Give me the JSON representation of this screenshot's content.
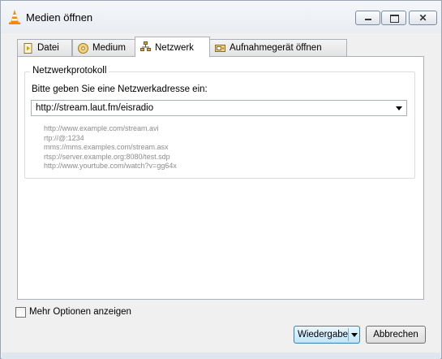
{
  "window": {
    "title": "Medien öffnen",
    "icon": "vlc-cone-icon",
    "controls": {
      "minimize": "minimize-icon",
      "maximize": "maximize-icon",
      "close_glyph": "✕"
    }
  },
  "tabs": [
    {
      "label": "Datei",
      "icon": "file-icon",
      "active": false
    },
    {
      "label": "Medium",
      "icon": "disc-icon",
      "active": false
    },
    {
      "label": "Netzwerk",
      "icon": "network-icon",
      "active": true
    },
    {
      "label": "Aufnahmegerät öffnen",
      "icon": "capture-device-icon",
      "active": false
    }
  ],
  "network": {
    "group_title": "Netzwerkprotokoll",
    "prompt": "Bitte geben Sie eine Netzwerkadresse ein:",
    "url_value": "http://stream.laut.fm/eisradio",
    "examples": [
      "http://www.example.com/stream.avi",
      "rtp://@:1234",
      "mms://mms.examples.com/stream.asx",
      "rtsp://server.example.org:8080/test.sdp",
      "http://www.yourtube.com/watch?v=gg64x"
    ]
  },
  "options": {
    "more_options_label": "Mehr Optionen anzeigen",
    "checked": false
  },
  "buttons": {
    "play_label": "Wiedergabe",
    "cancel_label": "Abbrechen"
  },
  "colors": {
    "accent_button": "#bee6fd",
    "vlc_orange": "#f08a00"
  }
}
